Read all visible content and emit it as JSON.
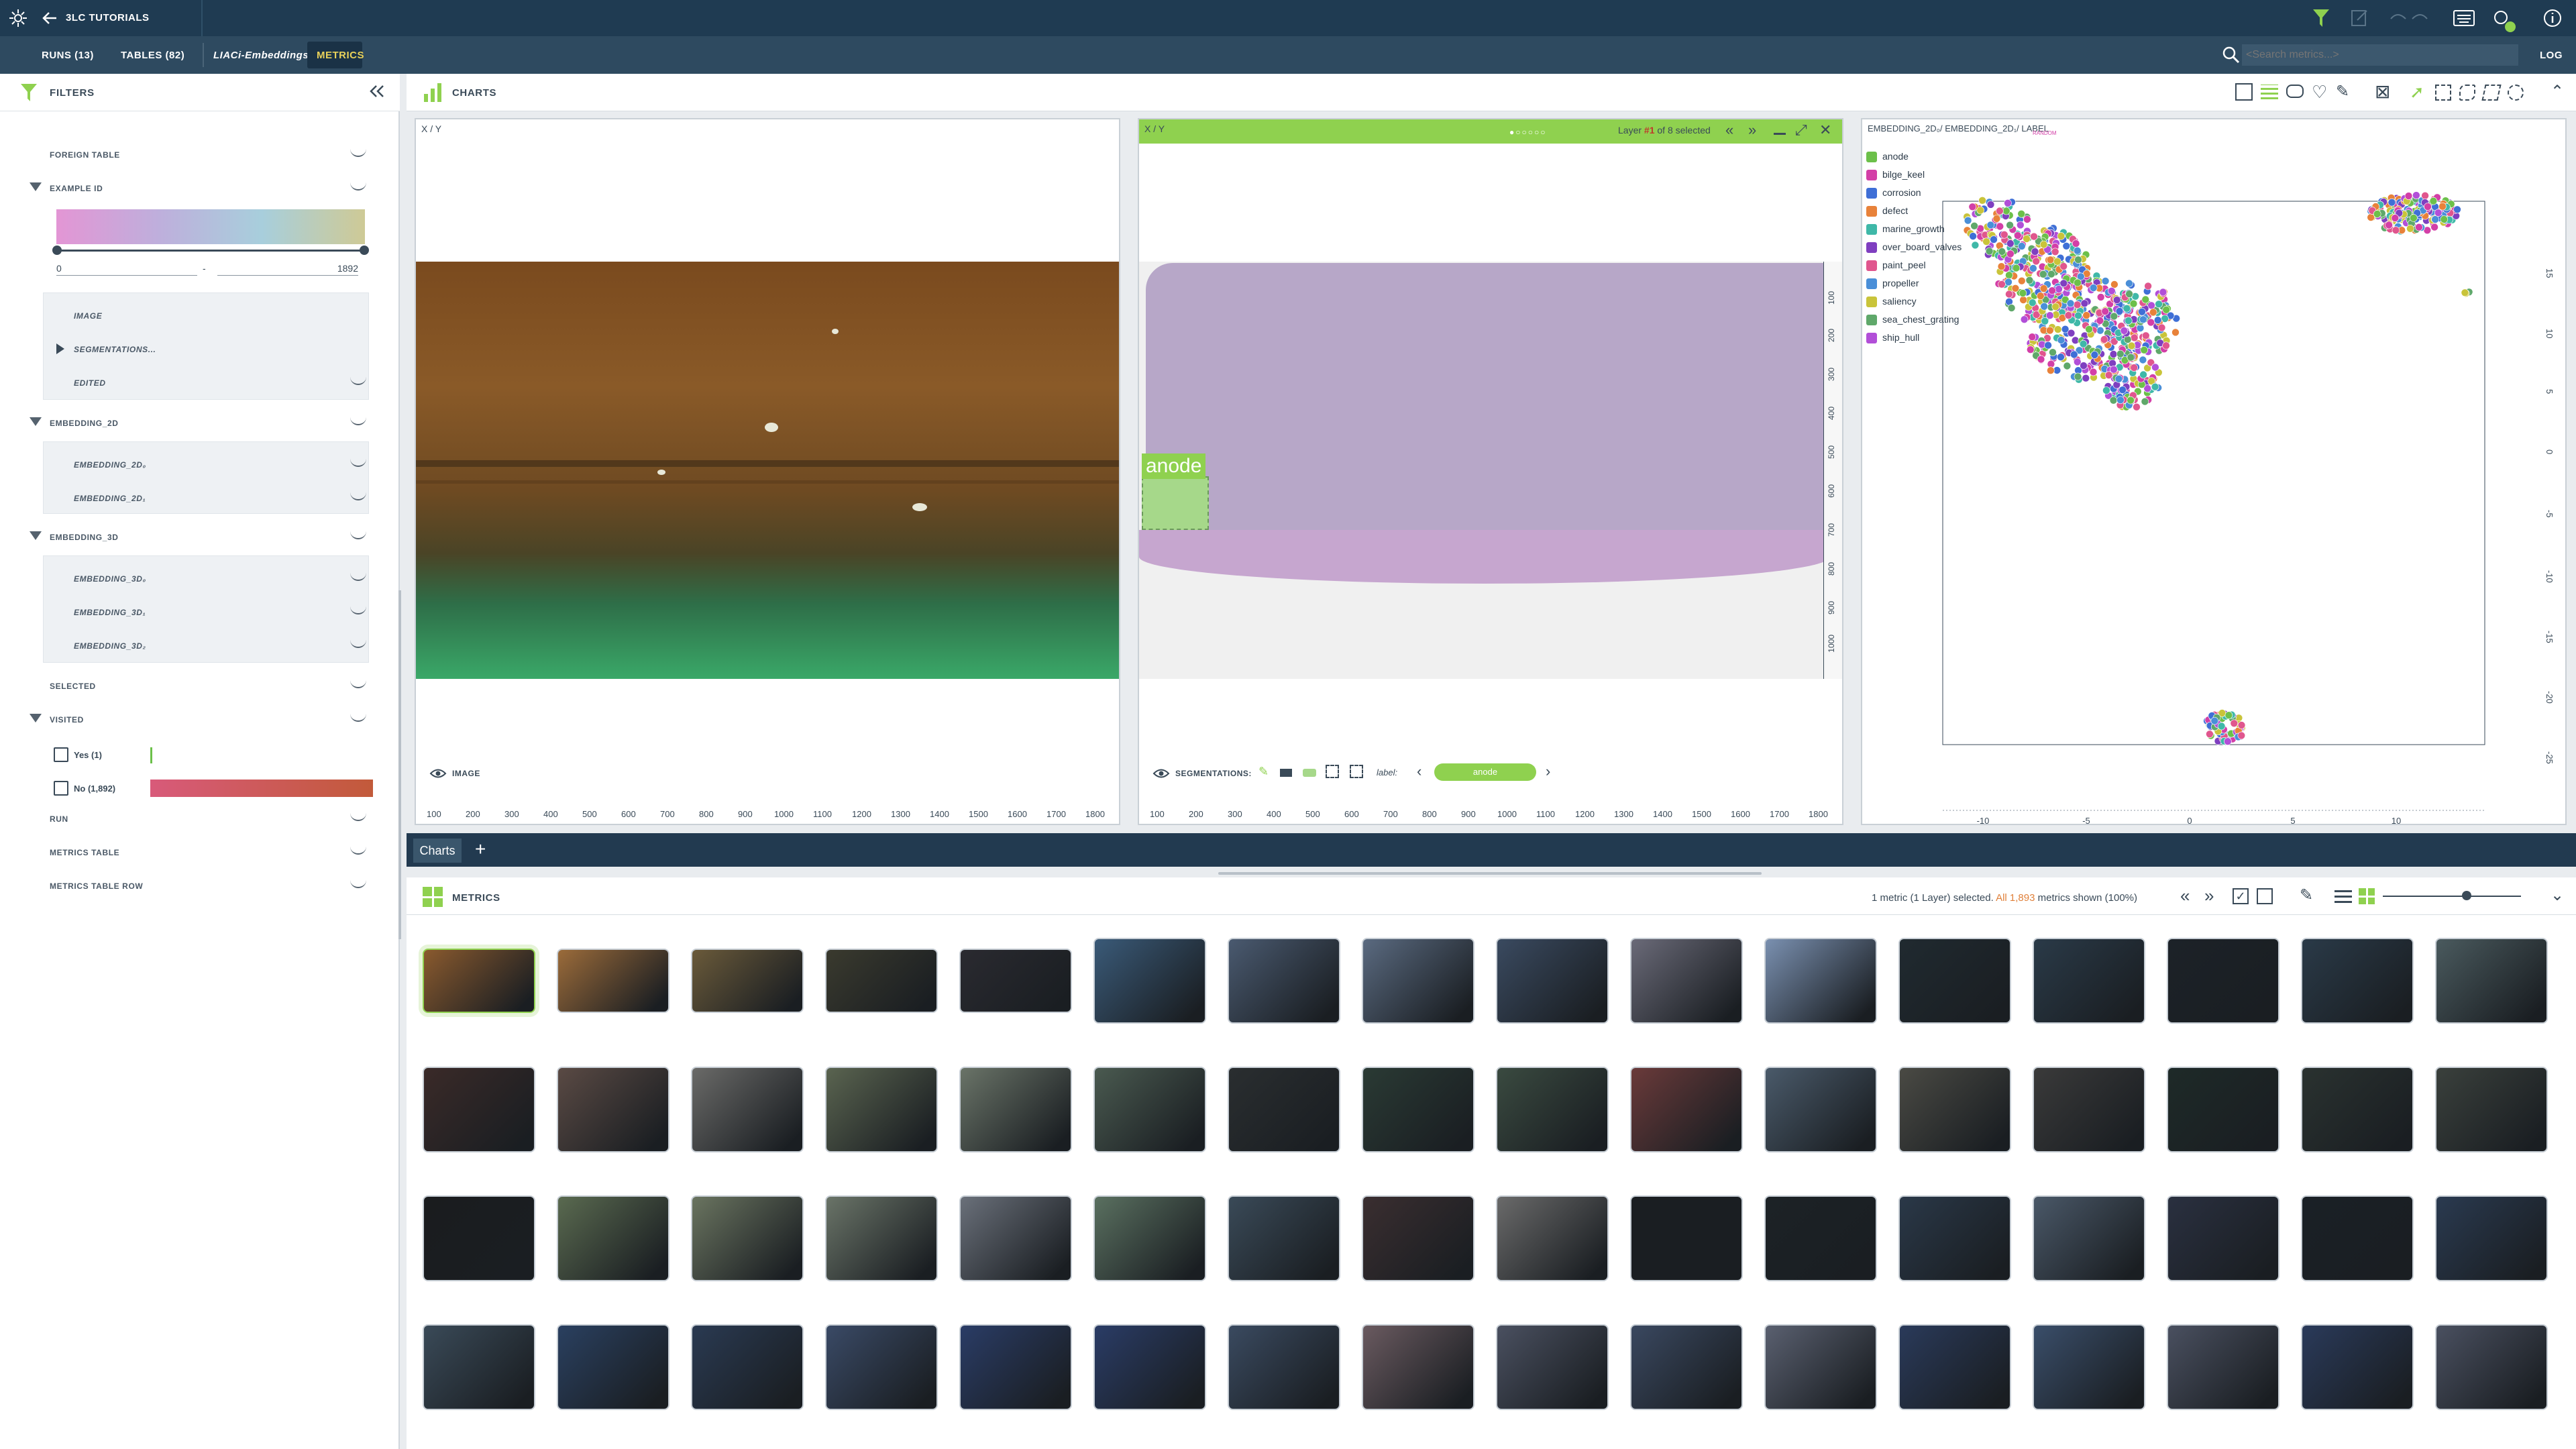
{
  "app": {
    "project_label": "3LC TUTORIALS"
  },
  "nav": {
    "runs": "RUNS (13)",
    "tables": "TABLES (82)",
    "breadcrumb_dataset": "LIACi-Embeddings:",
    "active_tab": "METRICS",
    "log": "LOG"
  },
  "search": {
    "placeholder": "<Search metrics...>"
  },
  "filters": {
    "title": "FILTERS",
    "foreign_table": "FOREIGN TABLE",
    "example_id": {
      "label": "EXAMPLE ID",
      "min": "0",
      "sep": "-",
      "max": "1892"
    },
    "example_sub": [
      "IMAGE",
      "SEGMENTATIONS...",
      "EDITED"
    ],
    "embedding_2d": {
      "label": "EMBEDDING_2D",
      "items": [
        "EMBEDDING_2D₀",
        "EMBEDDING_2D₁"
      ]
    },
    "embedding_3d": {
      "label": "EMBEDDING_3D",
      "items": [
        "EMBEDDING_3D₀",
        "EMBEDDING_3D₁",
        "EMBEDDING_3D₂"
      ]
    },
    "selected": "SELECTED",
    "visited": {
      "label": "VISITED",
      "yes": "Yes (1)",
      "no": "No (1,892)"
    },
    "run": "RUN",
    "metrics_table": "METRICS TABLE",
    "metrics_table_row": "METRICS TABLE ROW"
  },
  "charts_header": {
    "title": "CHARTS"
  },
  "panel1": {
    "label": "X / Y",
    "bottom_label": "IMAGE",
    "x_ticks": [
      "100",
      "200",
      "300",
      "400",
      "500",
      "600",
      "700",
      "800",
      "900",
      "1000",
      "1100",
      "1200",
      "1300",
      "1400",
      "1500",
      "1600",
      "1700",
      "1800"
    ]
  },
  "panel2": {
    "label": "X / Y",
    "layer_text_1": "Layer ",
    "layer_num": "#1",
    "layer_text_2": " of 8 selected",
    "annotation": "anode",
    "bottom_label": "SEGMENTATIONS:",
    "label_field": "label:",
    "label_value": "anode",
    "y_ticks": [
      "100",
      "200",
      "300",
      "400",
      "500",
      "600",
      "700",
      "800",
      "900",
      "1000"
    ]
  },
  "panel3": {
    "title": "EMBEDDING_2D₀/ EMBEDDING_2D₁/ LABEL",
    "random_tag": "RANDOM",
    "legend": [
      {
        "name": "anode",
        "color": "#6cc04a"
      },
      {
        "name": "bilge_keel",
        "color": "#d33fa7"
      },
      {
        "name": "corrosion",
        "color": "#3f6fd6"
      },
      {
        "name": "defect",
        "color": "#e8823a"
      },
      {
        "name": "marine_growth",
        "color": "#3fb8a8"
      },
      {
        "name": "over_board_valves",
        "color": "#7f3fc0"
      },
      {
        "name": "paint_peel",
        "color": "#e0568e"
      },
      {
        "name": "propeller",
        "color": "#4a8fd8"
      },
      {
        "name": "saliency",
        "color": "#c9c43a"
      },
      {
        "name": "sea_chest_grating",
        "color": "#5fa86a"
      },
      {
        "name": "ship_hull",
        "color": "#b24fd8"
      }
    ],
    "x_ticks": [
      "-10",
      "-5",
      "0",
      "5",
      "10"
    ],
    "y_ticks": [
      "15",
      "10",
      "5",
      "0",
      "-5",
      "-10",
      "-15",
      "-20",
      "-25"
    ]
  },
  "tabs": {
    "charts": "Charts",
    "add": "+"
  },
  "metrics": {
    "title": "METRICS",
    "status_1": "1 metric (1 Layer)  selected. ",
    "status_2": "All 1,893",
    "status_3": " metrics shown (100%)"
  },
  "thumbnails": {
    "rows": [
      [
        "#8a5a2e",
        "#9b6b3a",
        "#6a5a3a",
        "#3a3a2e",
        "#2a2a30",
        "#3a5a78",
        "#4a5a70",
        "#5a6a80",
        "#3a4a60",
        "#6a6a78",
        "#7a90b0",
        "#202a30",
        "#2a3a48",
        "#1c2228",
        "#2a3a48",
        "#4a5a5e"
      ],
      [
        "#3a2a28",
        "#5a4a44",
        "#6a6a68",
        "#5a6450",
        "#6a7468",
        "#4a5a50",
        "#2a2e30",
        "#2a3a34",
        "#3a4a40",
        "#6a3a3a",
        "#4a5a6a",
        "#4a4a44",
        "#3a3a3a",
        "#1e2a28",
        "#2a3230",
        "#3a403c"
      ],
      [
        "#1a1c1e",
        "#5a6a50",
        "#6a7460",
        "#6a7468",
        "#6a707a",
        "#5a7060",
        "#3a4a58",
        "#3a2e30",
        "#6a6a6a",
        "#1a1e22",
        "#1c2226",
        "#2a3848",
        "#4a5868",
        "#2a3040",
        "#1a2026",
        "#2a3a50"
      ],
      [
        "#3a4a58",
        "#2a4060",
        "#2a3a52",
        "#3a4a66",
        "#2a3c66",
        "#2a3c66",
        "#3a4a60",
        "#6a5a60",
        "#4a5060",
        "#3a4860",
        "#5a6070",
        "#2a3a5a",
        "#3a4e6a",
        "#4a5060",
        "#2a3a5a",
        "#4a5060"
      ]
    ]
  }
}
